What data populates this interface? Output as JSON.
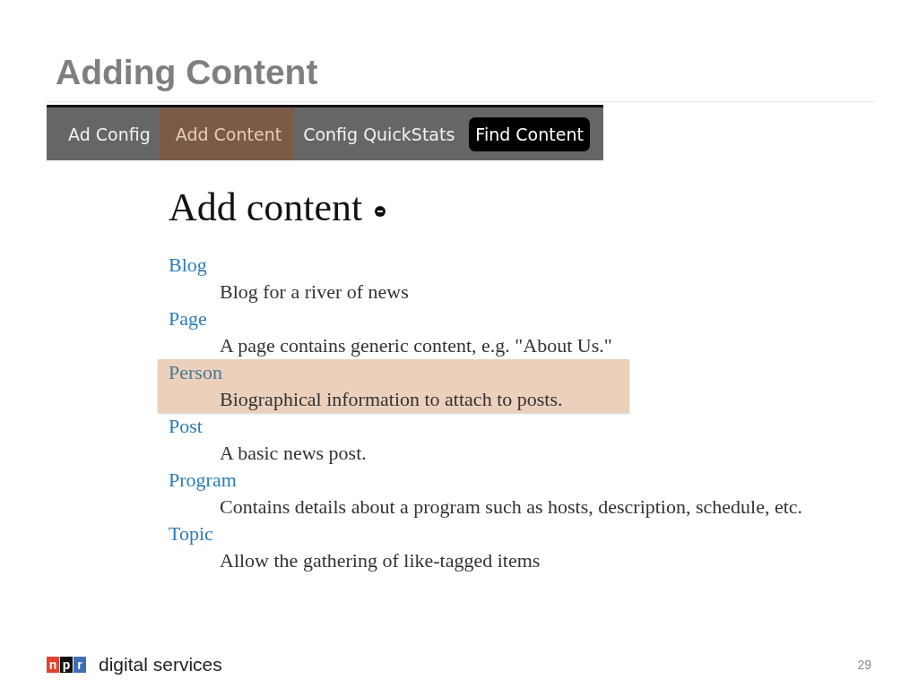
{
  "slide": {
    "title": "Adding Content",
    "page_number": "29"
  },
  "nav": {
    "tabs": [
      {
        "label": "Ad Config",
        "selected": false,
        "kind": "link"
      },
      {
        "label": "Add Content",
        "selected": true,
        "kind": "link"
      },
      {
        "label": "Config QuickStats",
        "selected": false,
        "kind": "link"
      },
      {
        "label": "Find Content",
        "selected": false,
        "kind": "button"
      }
    ]
  },
  "content": {
    "heading": "Add content",
    "types": [
      {
        "name": "Blog",
        "description": "Blog for a river of news",
        "highlighted": false
      },
      {
        "name": "Page",
        "description": "A page contains generic content, e.g. \"About Us.\"",
        "highlighted": false
      },
      {
        "name": "Person",
        "description": "Biographical information to attach to posts.",
        "highlighted": true
      },
      {
        "name": "Post",
        "description": "A basic news post.",
        "highlighted": false
      },
      {
        "name": "Program",
        "description": "Contains details about a program such as hosts, description, schedule, etc.",
        "highlighted": false
      },
      {
        "name": "Topic",
        "description": "Allow the gathering of like-tagged items",
        "highlighted": false
      }
    ]
  },
  "footer": {
    "logo": [
      {
        "letter": "n",
        "color": "#e5412d"
      },
      {
        "letter": "p",
        "color": "#111111"
      },
      {
        "letter": "r",
        "color": "#3d6fb6"
      }
    ],
    "brand": "digital services"
  }
}
